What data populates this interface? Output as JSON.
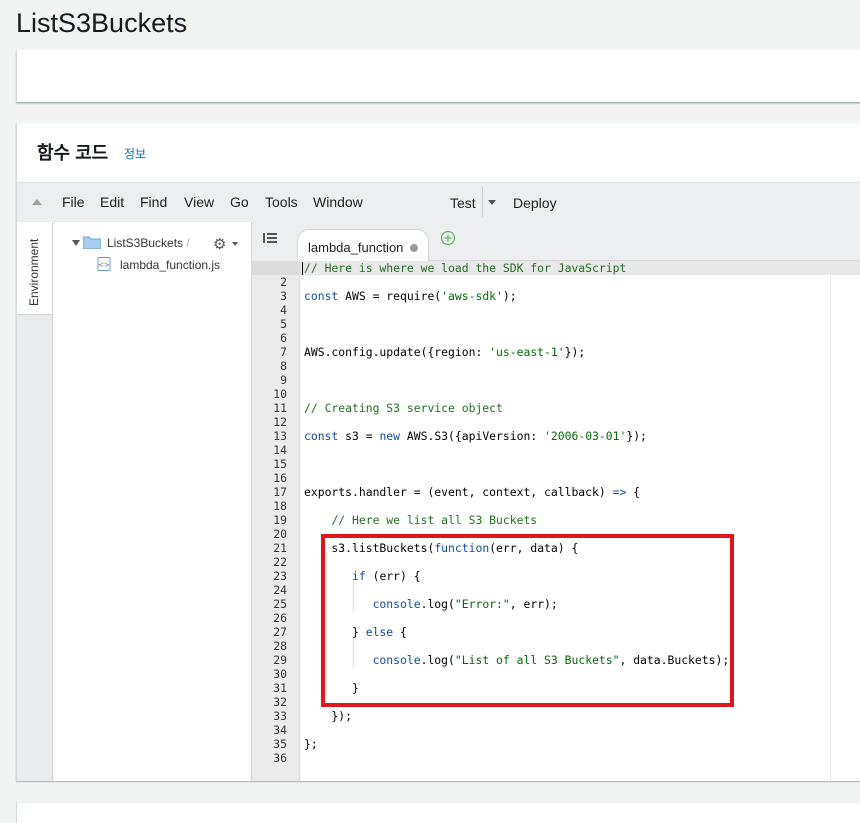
{
  "page": {
    "title": "ListS3Buckets"
  },
  "code_section": {
    "title": "함수 코드",
    "info_link": "정보"
  },
  "menubar": {
    "items": [
      "File",
      "Edit",
      "Find",
      "View",
      "Go",
      "Tools",
      "Window"
    ],
    "test_label": "Test",
    "deploy_label": "Deploy"
  },
  "environment": {
    "side_tab_label": "Environment",
    "root_folder": "ListS3Buckets",
    "root_suffix": "- /",
    "file": "lambda_function.js"
  },
  "editor": {
    "tab_label": "lambda_function",
    "lines": [
      [
        [
          "comment",
          "// Here is where we load the SDK for JavaScript"
        ]
      ],
      [],
      [
        [
          "kw",
          "const"
        ],
        [
          "plain",
          " AWS = require("
        ],
        [
          "str",
          "'aws-sdk'"
        ],
        [
          "plain",
          ");"
        ]
      ],
      [],
      [],
      [],
      [
        [
          "plain",
          "AWS.config.update({region: "
        ],
        [
          "str",
          "'us-east-1'"
        ],
        [
          "plain",
          "});"
        ]
      ],
      [],
      [],
      [],
      [
        [
          "comment",
          "// Creating S3 service object"
        ]
      ],
      [],
      [
        [
          "kw",
          "const"
        ],
        [
          "plain",
          " s3 = "
        ],
        [
          "kw",
          "new"
        ],
        [
          "plain",
          " AWS.S3({apiVersion: "
        ],
        [
          "str",
          "'2006-03-01'"
        ],
        [
          "plain",
          "});"
        ]
      ],
      [],
      [],
      [],
      [
        [
          "plain",
          "exports.handler = (event, context, callback) "
        ],
        [
          "kw",
          "=>"
        ],
        [
          "plain",
          " {"
        ]
      ],
      [],
      [
        [
          "plain",
          "    "
        ],
        [
          "comment",
          "// Here we list all S3 Buckets"
        ]
      ],
      [],
      [
        [
          "plain",
          "    s3.listBuckets("
        ],
        [
          "kw",
          "function"
        ],
        [
          "plain",
          "(err, data) {"
        ]
      ],
      [],
      [
        [
          "plain",
          "       "
        ],
        [
          "kw",
          "if"
        ],
        [
          "plain",
          " (err) {"
        ]
      ],
      [],
      [
        [
          "plain",
          "          "
        ],
        [
          "kw",
          "console"
        ],
        [
          "plain",
          ".log("
        ],
        [
          "str",
          "\"Error:\""
        ],
        [
          "plain",
          ", err);"
        ]
      ],
      [],
      [
        [
          "plain",
          "       } "
        ],
        [
          "kw",
          "else"
        ],
        [
          "plain",
          " {"
        ]
      ],
      [],
      [
        [
          "plain",
          "          "
        ],
        [
          "kw",
          "console"
        ],
        [
          "plain",
          ".log("
        ],
        [
          "str",
          "\"List of all S3 Buckets\""
        ],
        [
          "plain",
          ", data.Buckets);"
        ]
      ],
      [],
      [
        [
          "plain",
          "       }"
        ]
      ],
      [],
      [
        [
          "plain",
          "    });"
        ]
      ],
      [],
      [
        [
          "plain",
          "};"
        ]
      ],
      []
    ]
  },
  "colors": {
    "highlight_box": "#e0161e",
    "comment": "#236e24",
    "keyword": "#0f4a9e",
    "string": "#036a07",
    "link": "#0073bb"
  },
  "icons": {
    "folder": "folder-icon",
    "file": "js-file-icon",
    "gear": "gear-icon",
    "add_tab": "plus-circle-icon",
    "tab_list": "tab-list-icon"
  }
}
